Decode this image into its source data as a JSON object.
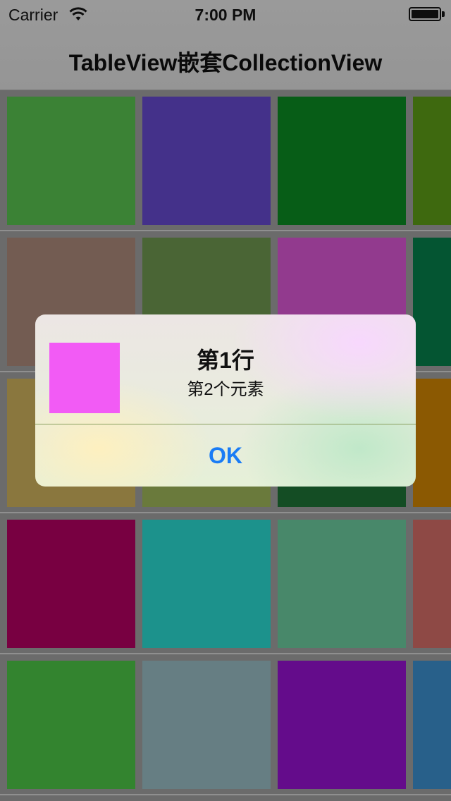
{
  "status_bar": {
    "carrier": "Carrier",
    "time": "7:00 PM",
    "wifi_icon": "wifi-icon",
    "battery_icon": "battery-icon"
  },
  "nav": {
    "title": "TableView嵌套CollectionView"
  },
  "rows": [
    {
      "colors": [
        "#3b8235",
        "#44318a",
        "#075d17",
        "#3e690f"
      ]
    },
    {
      "colors": [
        "#735c52",
        "#4a6535",
        "#923a8e",
        "#045532"
      ]
    },
    {
      "colors": [
        "#8a773e",
        "#6a7a3c",
        "#144d24",
        "#8b5902"
      ]
    },
    {
      "colors": [
        "#780041",
        "#1c928c",
        "#48886a",
        "#8e4945"
      ]
    },
    {
      "colors": [
        "#33842f",
        "#667e83",
        "#640c8b",
        "#28608a"
      ]
    }
  ],
  "alert": {
    "image_color": "#f25bf5",
    "title": "第1行",
    "message": "第2个元素",
    "ok_label": "OK",
    "accent": "#1a7cf5"
  }
}
